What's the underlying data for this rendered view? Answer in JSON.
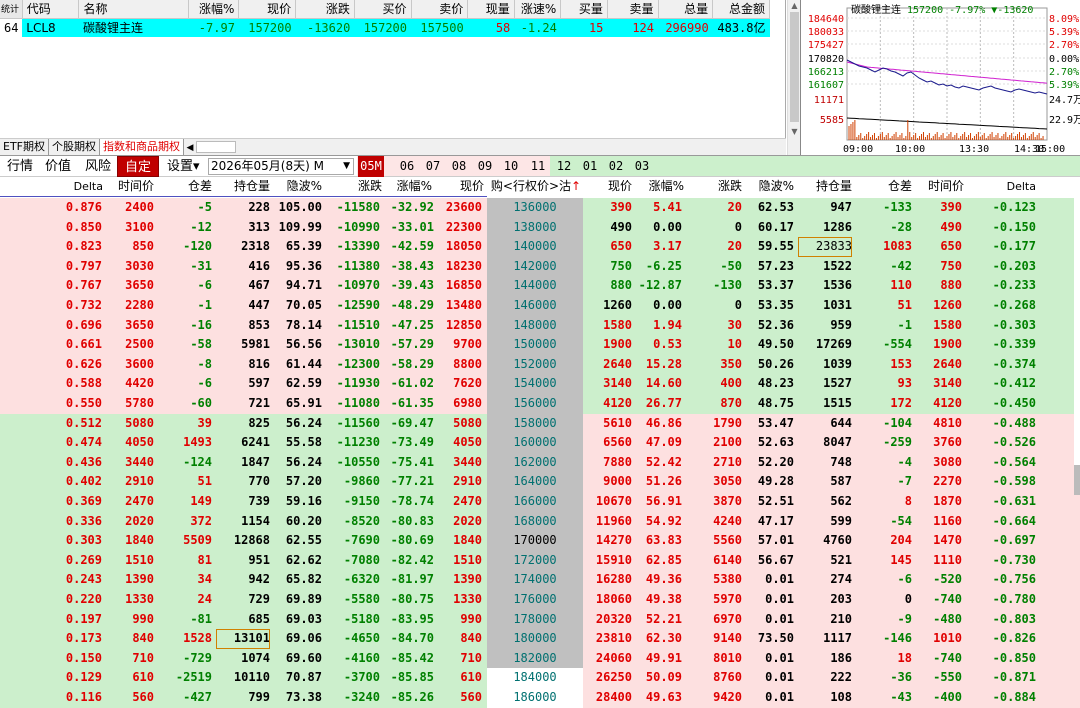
{
  "quote_header": {
    "cols": [
      "统计",
      "代码",
      "名称",
      "涨幅%",
      "现价",
      "涨跌",
      "买价",
      "卖价",
      "现量",
      "涨速%",
      "买量",
      "卖量",
      "总量",
      "总金额"
    ]
  },
  "quote_row": {
    "index": "64",
    "code": "LCL8",
    "name": "碳酸锂主连",
    "pct": "-7.97",
    "price": "157200",
    "change": "-13620",
    "bid": "157200",
    "ask": "157500",
    "vol": "58",
    "speed": "-1.24",
    "bid_vol": "15",
    "ask_vol": "124",
    "total_vol": "296990",
    "amount": "483.8亿"
  },
  "tabs": [
    "ETF期权",
    "个股期权",
    "指数和商品期权"
  ],
  "mini_chart": {
    "title": "碳酸锂主连",
    "quote": "157200 -7.97% ▼-13620",
    "prices": [
      "184640",
      "180033",
      "175427",
      "170820",
      "166213",
      "161607",
      "11171",
      "5585"
    ],
    "pcts": [
      "8.09%",
      "5.39%",
      "2.70%",
      "0.00%",
      "2.70%",
      "5.39%",
      "24.7万",
      "22.9万"
    ],
    "times": [
      "09:00",
      "10:00",
      "13:30",
      "14:30",
      "15:00"
    ],
    "colors": {
      "price_line": "#1a1a8c",
      "avg_line": "#d020d0",
      "vol": "#d04000",
      "pos": "#e00000",
      "neg": "#008000"
    }
  },
  "toolbar": {
    "items": [
      "行情",
      "价值",
      "风险",
      "自定",
      "设置▾"
    ],
    "date": "2026年05月(8天) M",
    "months": [
      "05M",
      "06",
      "07",
      "08",
      "09",
      "10",
      "11",
      "12",
      "01",
      "02",
      "03"
    ]
  },
  "grid_header": {
    "call": [
      "Delta",
      "时间价",
      "仓差",
      "持仓量",
      "隐波%",
      "涨跌",
      "涨幅%",
      "现价"
    ],
    "strike": "购<行权价>沽",
    "put": [
      "现价",
      "涨幅%",
      "涨跌",
      "隐波%",
      "持仓量",
      "仓差",
      "时间价",
      "Delta"
    ]
  },
  "rows": [
    {
      "c": [
        "0.876",
        "2400",
        "-5",
        "228",
        "105.00",
        "-11580",
        "-32.92",
        "23600"
      ],
      "k": "136000",
      "p": [
        "390",
        "5.41",
        "20",
        "62.53",
        "947",
        "-133",
        "390",
        "-0.123"
      ]
    },
    {
      "c": [
        "0.850",
        "3100",
        "-12",
        "313",
        "109.99",
        "-10990",
        "-33.01",
        "22300"
      ],
      "k": "138000",
      "p": [
        "490",
        "0.00",
        "0",
        "60.17",
        "1286",
        "-28",
        "490",
        "-0.150"
      ]
    },
    {
      "c": [
        "0.823",
        "850",
        "-120",
        "2318",
        "65.39",
        "-13390",
        "-42.59",
        "18050"
      ],
      "k": "140000",
      "p": [
        "650",
        "3.17",
        "20",
        "59.55",
        "23833",
        "1083",
        "650",
        "-0.177"
      ]
    },
    {
      "c": [
        "0.797",
        "3030",
        "-31",
        "416",
        "95.36",
        "-11380",
        "-38.43",
        "18230"
      ],
      "k": "142000",
      "p": [
        "750",
        "-6.25",
        "-50",
        "57.23",
        "1522",
        "-42",
        "750",
        "-0.203"
      ]
    },
    {
      "c": [
        "0.767",
        "3650",
        "-6",
        "467",
        "94.71",
        "-10970",
        "-39.43",
        "16850"
      ],
      "k": "144000",
      "p": [
        "880",
        "-12.87",
        "-130",
        "53.37",
        "1536",
        "110",
        "880",
        "-0.233"
      ]
    },
    {
      "c": [
        "0.732",
        "2280",
        "-1",
        "447",
        "70.05",
        "-12590",
        "-48.29",
        "13480"
      ],
      "k": "146000",
      "p": [
        "1260",
        "0.00",
        "0",
        "53.35",
        "1031",
        "51",
        "1260",
        "-0.268"
      ]
    },
    {
      "c": [
        "0.696",
        "3650",
        "-16",
        "853",
        "78.14",
        "-11510",
        "-47.25",
        "12850"
      ],
      "k": "148000",
      "p": [
        "1580",
        "1.94",
        "30",
        "52.36",
        "959",
        "-1",
        "1580",
        "-0.303"
      ]
    },
    {
      "c": [
        "0.661",
        "2500",
        "-58",
        "5981",
        "56.56",
        "-13010",
        "-57.29",
        "9700"
      ],
      "k": "150000",
      "p": [
        "1900",
        "0.53",
        "10",
        "49.50",
        "17269",
        "-554",
        "1900",
        "-0.339"
      ]
    },
    {
      "c": [
        "0.626",
        "3600",
        "-8",
        "816",
        "61.44",
        "-12300",
        "-58.29",
        "8800"
      ],
      "k": "152000",
      "p": [
        "2640",
        "15.28",
        "350",
        "50.26",
        "1039",
        "153",
        "2640",
        "-0.374"
      ]
    },
    {
      "c": [
        "0.588",
        "4420",
        "-6",
        "597",
        "62.59",
        "-11930",
        "-61.02",
        "7620"
      ],
      "k": "154000",
      "p": [
        "3140",
        "14.60",
        "400",
        "48.23",
        "1527",
        "93",
        "3140",
        "-0.412"
      ]
    },
    {
      "c": [
        "0.550",
        "5780",
        "-60",
        "721",
        "65.91",
        "-11080",
        "-61.35",
        "6980"
      ],
      "k": "156000",
      "p": [
        "4120",
        "26.77",
        "870",
        "48.75",
        "1515",
        "172",
        "4120",
        "-0.450"
      ]
    },
    {
      "c": [
        "0.512",
        "5080",
        "39",
        "825",
        "56.24",
        "-11560",
        "-69.47",
        "5080"
      ],
      "k": "158000",
      "p": [
        "5610",
        "46.86",
        "1790",
        "53.47",
        "644",
        "-104",
        "4810",
        "-0.488"
      ]
    },
    {
      "c": [
        "0.474",
        "4050",
        "1493",
        "6241",
        "55.58",
        "-11230",
        "-73.49",
        "4050"
      ],
      "k": "160000",
      "p": [
        "6560",
        "47.09",
        "2100",
        "52.63",
        "8047",
        "-259",
        "3760",
        "-0.526"
      ]
    },
    {
      "c": [
        "0.436",
        "3440",
        "-124",
        "1847",
        "56.24",
        "-10550",
        "-75.41",
        "3440"
      ],
      "k": "162000",
      "p": [
        "7880",
        "52.42",
        "2710",
        "52.20",
        "748",
        "-4",
        "3080",
        "-0.564"
      ]
    },
    {
      "c": [
        "0.402",
        "2910",
        "51",
        "770",
        "57.20",
        "-9860",
        "-77.21",
        "2910"
      ],
      "k": "164000",
      "p": [
        "9000",
        "51.26",
        "3050",
        "49.28",
        "587",
        "-7",
        "2270",
        "-0.598"
      ]
    },
    {
      "c": [
        "0.369",
        "2470",
        "149",
        "739",
        "59.16",
        "-9150",
        "-78.74",
        "2470"
      ],
      "k": "166000",
      "p": [
        "10670",
        "56.91",
        "3870",
        "52.51",
        "562",
        "8",
        "1870",
        "-0.631"
      ]
    },
    {
      "c": [
        "0.336",
        "2020",
        "372",
        "1154",
        "60.20",
        "-8520",
        "-80.83",
        "2020"
      ],
      "k": "168000",
      "p": [
        "11960",
        "54.92",
        "4240",
        "47.17",
        "599",
        "-54",
        "1160",
        "-0.664"
      ]
    },
    {
      "c": [
        "0.303",
        "1840",
        "5509",
        "12868",
        "62.55",
        "-7690",
        "-80.69",
        "1840"
      ],
      "k": "170000",
      "p": [
        "14270",
        "63.83",
        "5560",
        "57.01",
        "4760",
        "204",
        "1470",
        "-0.697"
      ]
    },
    {
      "c": [
        "0.269",
        "1510",
        "81",
        "951",
        "62.62",
        "-7080",
        "-82.42",
        "1510"
      ],
      "k": "172000",
      "p": [
        "15910",
        "62.85",
        "6140",
        "56.67",
        "521",
        "145",
        "1110",
        "-0.730"
      ]
    },
    {
      "c": [
        "0.243",
        "1390",
        "34",
        "942",
        "65.82",
        "-6320",
        "-81.97",
        "1390"
      ],
      "k": "174000",
      "p": [
        "16280",
        "49.36",
        "5380",
        "0.01",
        "274",
        "-6",
        "-520",
        "-0.756"
      ]
    },
    {
      "c": [
        "0.220",
        "1330",
        "24",
        "729",
        "69.89",
        "-5580",
        "-80.75",
        "1330"
      ],
      "k": "176000",
      "p": [
        "18060",
        "49.38",
        "5970",
        "0.01",
        "203",
        "0",
        "-740",
        "-0.780"
      ]
    },
    {
      "c": [
        "0.197",
        "990",
        "-81",
        "685",
        "69.03",
        "-5180",
        "-83.95",
        "990"
      ],
      "k": "178000",
      "p": [
        "20320",
        "52.21",
        "6970",
        "0.01",
        "210",
        "-9",
        "-480",
        "-0.803"
      ]
    },
    {
      "c": [
        "0.173",
        "840",
        "1528",
        "13101",
        "69.06",
        "-4650",
        "-84.70",
        "840"
      ],
      "k": "180000",
      "p": [
        "23810",
        "62.30",
        "9140",
        "73.50",
        "1117",
        "-146",
        "1010",
        "-0.826"
      ]
    },
    {
      "c": [
        "0.150",
        "710",
        "-729",
        "1074",
        "69.60",
        "-4160",
        "-85.42",
        "710"
      ],
      "k": "182000",
      "p": [
        "24060",
        "49.91",
        "8010",
        "0.01",
        "186",
        "18",
        "-740",
        "-0.850"
      ]
    },
    {
      "c": [
        "0.129",
        "610",
        "-2519",
        "10110",
        "70.87",
        "-3700",
        "-85.85",
        "610"
      ],
      "k": "184000",
      "p": [
        "26250",
        "50.09",
        "8760",
        "0.01",
        "222",
        "-36",
        "-550",
        "-0.871"
      ]
    },
    {
      "c": [
        "0.116",
        "560",
        "-427",
        "799",
        "73.38",
        "-3240",
        "-85.26",
        "560"
      ],
      "k": "186000",
      "p": [
        "28400",
        "49.63",
        "9420",
        "0.01",
        "108",
        "-43",
        "-400",
        "-0.884"
      ]
    }
  ],
  "colors": {
    "itm_call_bg": "#fde0e0",
    "otm_call_bg": "#ccefcc",
    "strike_bg": "#c0c0c0",
    "red": "#e00000",
    "green": "#008000",
    "accent": "#c00000",
    "quote_bg": "#00ffff"
  }
}
